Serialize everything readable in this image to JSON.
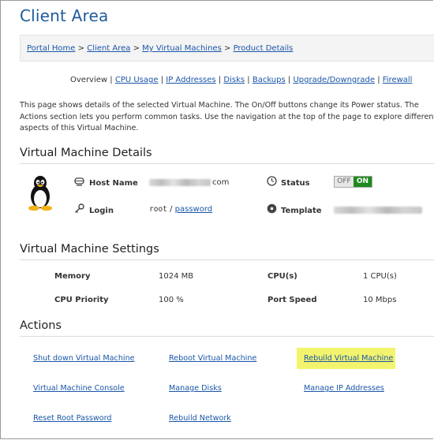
{
  "page": {
    "title": "Client Area"
  },
  "breadcrumb": {
    "items": [
      "Portal Home",
      "Client Area",
      "My Virtual Machines",
      "Product Details"
    ],
    "separator": ">"
  },
  "tabs": {
    "items": [
      "Overview",
      "CPU Usage",
      "IP Addresses",
      "Disks",
      "Backups",
      "Upgrade/Downgrade",
      "Firewall"
    ],
    "separator": "|",
    "active_index": 0
  },
  "description": "This page shows details of the selected Virtual Machine. The On/Off buttons change its Power status. The Actions section lets you perform common tasks. Use the navigation at the top of the page to explore different aspects of this Virtual Machine.",
  "details": {
    "heading": "Virtual Machine Details",
    "os_icon": "linux-tux-icon",
    "host_name_label": "Host Name",
    "host_name_suffix": "com",
    "login_label": "Login",
    "login_user": "root",
    "login_separator": "/",
    "login_password_link": "password",
    "status_label": "Status",
    "status_off": "OFF",
    "status_on": "ON",
    "status_value": "on",
    "template_label": "Template"
  },
  "settings": {
    "heading": "Virtual Machine Settings",
    "memory_label": "Memory",
    "memory_value": "1024 MB",
    "cpus_label": "CPU(s)",
    "cpus_value": "1 CPU(s)",
    "priority_label": "CPU Priority",
    "priority_value": "100 %",
    "port_label": "Port Speed",
    "port_value": "10 Mbps"
  },
  "actions": {
    "heading": "Actions",
    "shutdown": "Shut down Virtual Machine",
    "reboot": "Reboot Virtual Machine",
    "rebuild": "Rebuild Virtual Machine",
    "console": "Virtual Machine Console",
    "disks": "Manage Disks",
    "ips": "Manage IP Addresses",
    "reset_pw": "Reset Root Password",
    "rebuild_net": "Rebuild Network",
    "highlight_color": "#f3f46d"
  },
  "colors": {
    "link": "#1a56a8",
    "title": "#1f5a9c",
    "on_green": "#1e8a1e"
  }
}
